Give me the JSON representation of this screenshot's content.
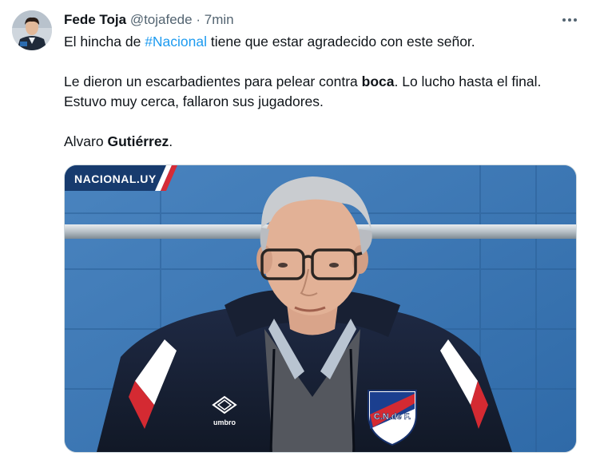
{
  "tweet": {
    "author": {
      "display_name": "Fede Toja",
      "handle": "@tojafede",
      "separator": "·",
      "time": "7min"
    },
    "more_icon": "more-horizontal-icon",
    "text": {
      "line1_prefix": "El hincha de ",
      "line1_hashtag": "#Nacional",
      "line1_suffix": " tiene que estar agradecido con este señor.",
      "para2_prefix": "Le dieron un escarbadientes para pelear contra ",
      "para2_bold": "boca",
      "para2_suffix": ". Lo lucho hasta el final. Estuvo muy cerca, fallaron sus jugadores.",
      "para3_prefix": "Alvaro ",
      "para3_bold": "Gutiérrez",
      "para3_suffix": "."
    },
    "media": {
      "watermark": "NACIONAL.UY",
      "jacket_brand": "umbro",
      "crest_text": "C.N.de F."
    }
  },
  "colors": {
    "link": "#1d9bf0",
    "secondary_text": "#536471",
    "wall_blue": "#3f78b2"
  }
}
